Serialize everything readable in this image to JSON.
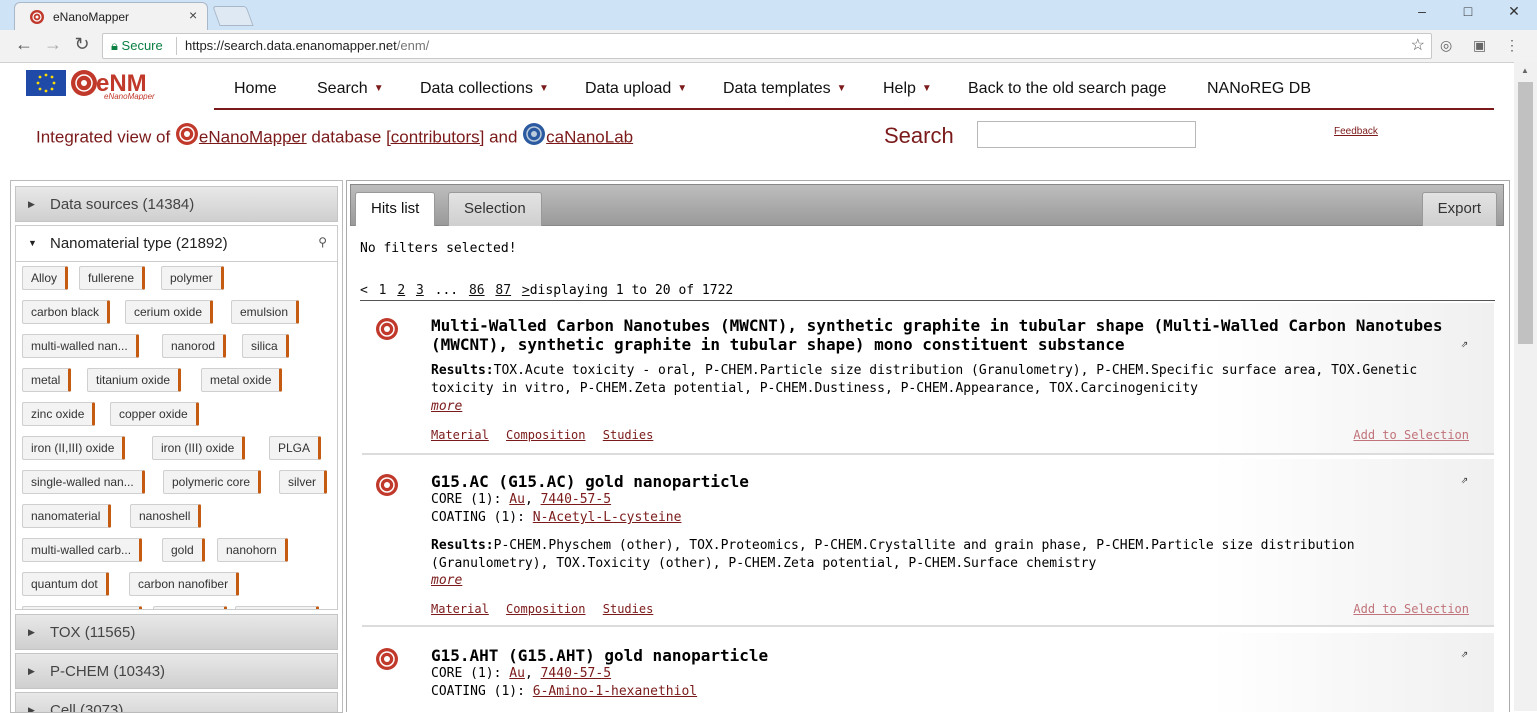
{
  "browser": {
    "tab_title": "eNanoMapper",
    "secure_label": "Secure",
    "url_host": "https://search.data.enanomapper.net",
    "url_path": "/enm/",
    "window_controls": [
      "–",
      "□",
      "✕"
    ]
  },
  "header": {
    "logo_text": "eNM",
    "logo_subtext": "eNanoMapper",
    "nav": [
      {
        "label": "Home",
        "has_caret": false
      },
      {
        "label": "Search",
        "has_caret": true
      },
      {
        "label": "Data collections",
        "has_caret": true
      },
      {
        "label": "Data upload",
        "has_caret": true
      },
      {
        "label": "Data templates",
        "has_caret": true
      },
      {
        "label": "Help",
        "has_caret": true
      },
      {
        "label": "Back to the old search page",
        "has_caret": false
      },
      {
        "label": "NANoREG DB",
        "has_caret": false
      }
    ],
    "caret_glyph": "▼",
    "integrated": {
      "prefix": "Integrated view of ",
      "enm_link": "eNanoMapper",
      "database": " database ",
      "contributors": "[contributors]",
      "and": " and ",
      "cananolab": "caNanoLab"
    },
    "search_label": "Search",
    "search_value": "",
    "feedback": "Feedback"
  },
  "facets": {
    "data_sources": "Data sources (14384)",
    "nanomaterial_type": "Nanomaterial type (21892)",
    "chips": [
      [
        "Alloy",
        "fullerene",
        "polymer"
      ],
      [
        "carbon black",
        "cerium oxide",
        "emulsion"
      ],
      [
        "multi-walled nan...",
        "nanorod",
        "silica"
      ],
      [
        "metal",
        "titanium oxide",
        "metal oxide"
      ],
      [
        "zinc oxide",
        "copper oxide"
      ],
      [
        "iron (II,III) oxide",
        "iron (III) oxide",
        "PLGA"
      ],
      [
        "single-walled nan...",
        "polymeric core",
        "silver"
      ],
      [
        "nanomaterial",
        "nanoshell"
      ],
      [
        "multi-walled carb...",
        "gold",
        "nanohorn"
      ],
      [
        "quantum dot",
        "carbon nanofiber"
      ]
    ],
    "tox": "TOX (11565)",
    "pchem": "P-CHEM (10343)",
    "cell": "Cell (3073)"
  },
  "results": {
    "tabs": [
      "Hits list",
      "Selection"
    ],
    "export": "Export",
    "no_filters": "No filters selected!",
    "pager": {
      "prev": "<",
      "pages": [
        "1",
        "2",
        "3"
      ],
      "ellipsis": "...",
      "last_pages": [
        "86",
        "87"
      ],
      "next": ">",
      "display": "displaying 1 to 20 of 1722"
    },
    "hits": [
      {
        "title": "Multi-Walled Carbon Nanotubes (MWCNT), synthetic graphite in tubular shape (Multi-Walled Carbon Nanotubes (MWCNT), synthetic graphite in tubular shape) mono constituent substance",
        "results_label": "Results:",
        "results_text": "TOX.Acute toxicity - oral, P-CHEM.Particle size distribution (Granulometry), P-CHEM.Specific surface area, TOX.Genetic toxicity in vitro, P-CHEM.Zeta potential, P-CHEM.Dustiness, P-CHEM.Appearance, TOX.Carcinogenicity",
        "more": "more",
        "links": [
          "Material",
          "Composition",
          "Studies"
        ],
        "add": "Add to Selection"
      },
      {
        "title": "G15.AC (G15.AC) gold nanoparticle",
        "core_label": "CORE (1): ",
        "core_el": "Au",
        "core_cas": "7440-57-5",
        "coating_label": "COATING (1): ",
        "coating": "N-Acetyl-L-cysteine",
        "results_label": "Results:",
        "results_text": "P-CHEM.Physchem (other), TOX.Proteomics, P-CHEM.Crystallite and grain phase, P-CHEM.Particle size distribution (Granulometry), TOX.Toxicity (other), P-CHEM.Zeta potential, P-CHEM.Surface chemistry",
        "more": "more",
        "links": [
          "Material",
          "Composition",
          "Studies"
        ],
        "add": "Add to Selection"
      },
      {
        "title": "G15.AHT (G15.AHT) gold nanoparticle",
        "core_label": "CORE (1): ",
        "core_el": "Au",
        "core_cas": "7440-57-5",
        "coating_label": "COATING (1): ",
        "coating": "6-Amino-1-hexanethiol"
      }
    ]
  },
  "colors": {
    "accent": "#7b1a1a",
    "chip_marker": "#c55a11",
    "add_link": "#c0737a"
  },
  "icons": {
    "external_link": "⇗",
    "magnifier": "⚲"
  }
}
